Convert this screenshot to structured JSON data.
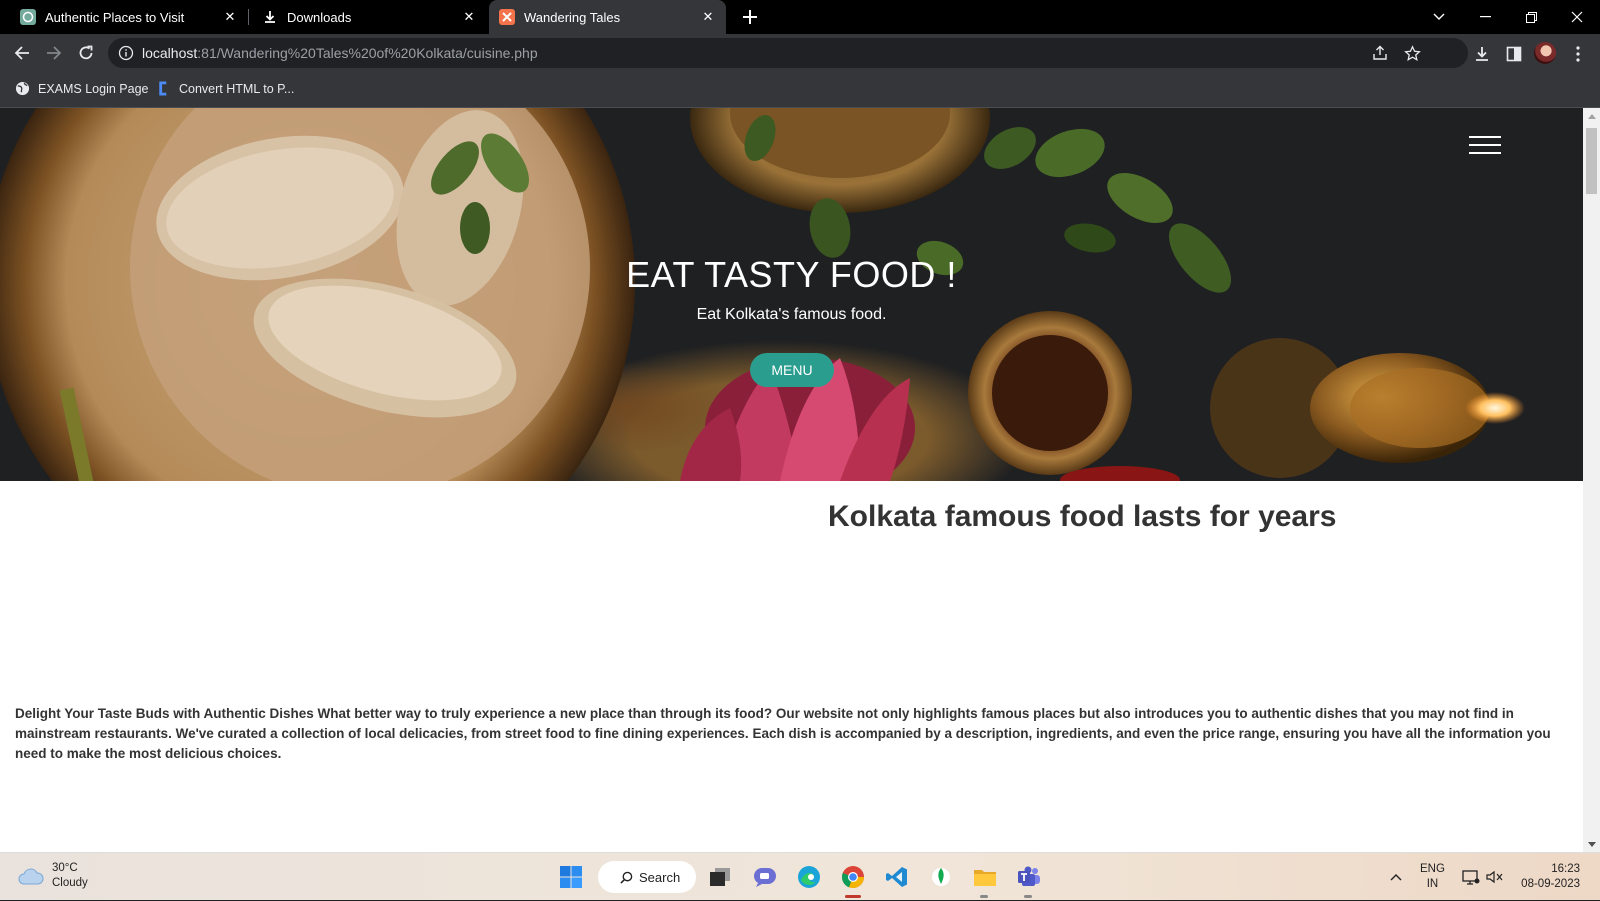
{
  "browser": {
    "tabs": [
      {
        "title": "Authentic Places to Visit",
        "favicon": "chatgpt-icon",
        "active": false
      },
      {
        "title": "Downloads",
        "favicon": "download-icon",
        "active": false
      },
      {
        "title": "Wandering Tales",
        "favicon": "xampp-icon",
        "active": true
      }
    ],
    "url_host": "localhost",
    "url_path": ":81/Wandering%20Tales%20of%20Kolkata/cuisine.php",
    "bookmarks": [
      {
        "label": "EXAMS Login Page",
        "icon": "globe-icon"
      },
      {
        "label": "Convert HTML to P...",
        "icon": "converter-icon"
      }
    ]
  },
  "page": {
    "hero": {
      "title": "EAT TASTY FOOD !",
      "subtitle": "Eat Kolkata's famous food.",
      "button": "MENU"
    },
    "heading": "Kolkata famous food lasts for years",
    "paragraph": "Delight Your Taste Buds with Authentic Dishes What better way to truly experience a new place than through its food? Our website not only highlights famous places but also introduces you to authentic dishes that you may not find in mainstream restaurants. We've curated a collection of local delicacies, from street food to fine dining experiences. Each dish is accompanied by a description, ingredients, and even the price range, ensuring you have all the information you need to make the most delicious choices."
  },
  "taskbar": {
    "weather_temp": "30°C",
    "weather_desc": "Cloudy",
    "search_label": "Search",
    "lang_top": "ENG",
    "lang_bottom": "IN",
    "time": "16:23",
    "date": "08-09-2023"
  },
  "colors": {
    "accent_button": "#2a9d8f",
    "chrome_dark": "#35363a"
  }
}
